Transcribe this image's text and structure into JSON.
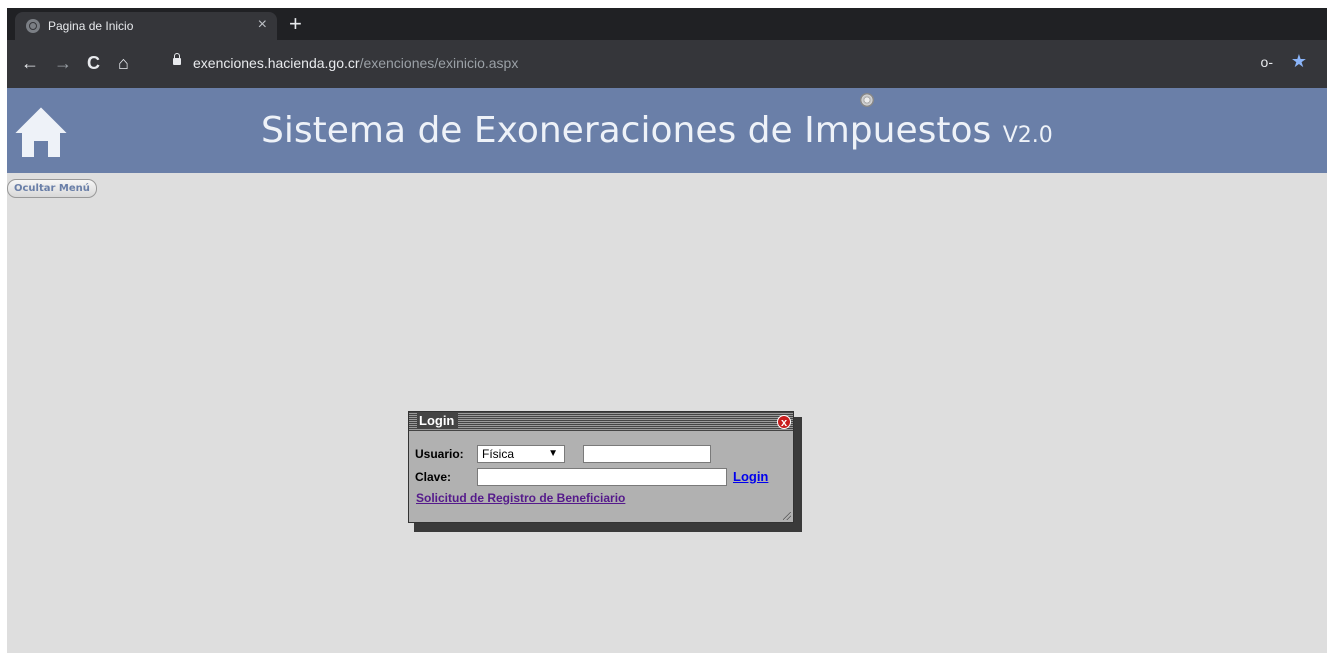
{
  "browser": {
    "tab_title": "Pagina de Inicio",
    "tab_close": "×",
    "new_tab": "+",
    "url_host": "exenciones.hacienda.go.cr",
    "url_path": "/exenciones/exinicio.aspx"
  },
  "header": {
    "title": "Sistema de Exoneraciones de Impuestos",
    "version": "V2.0"
  },
  "menu": {
    "hide_label": "Ocultar Menú"
  },
  "login": {
    "title": "Login",
    "user_label": "Usuario:",
    "user_type": "Física",
    "user_value": "",
    "password_label": "Clave:",
    "password_value": "",
    "submit_label": "Login",
    "register_link": "Solicitud de Registro de Beneficiario"
  }
}
